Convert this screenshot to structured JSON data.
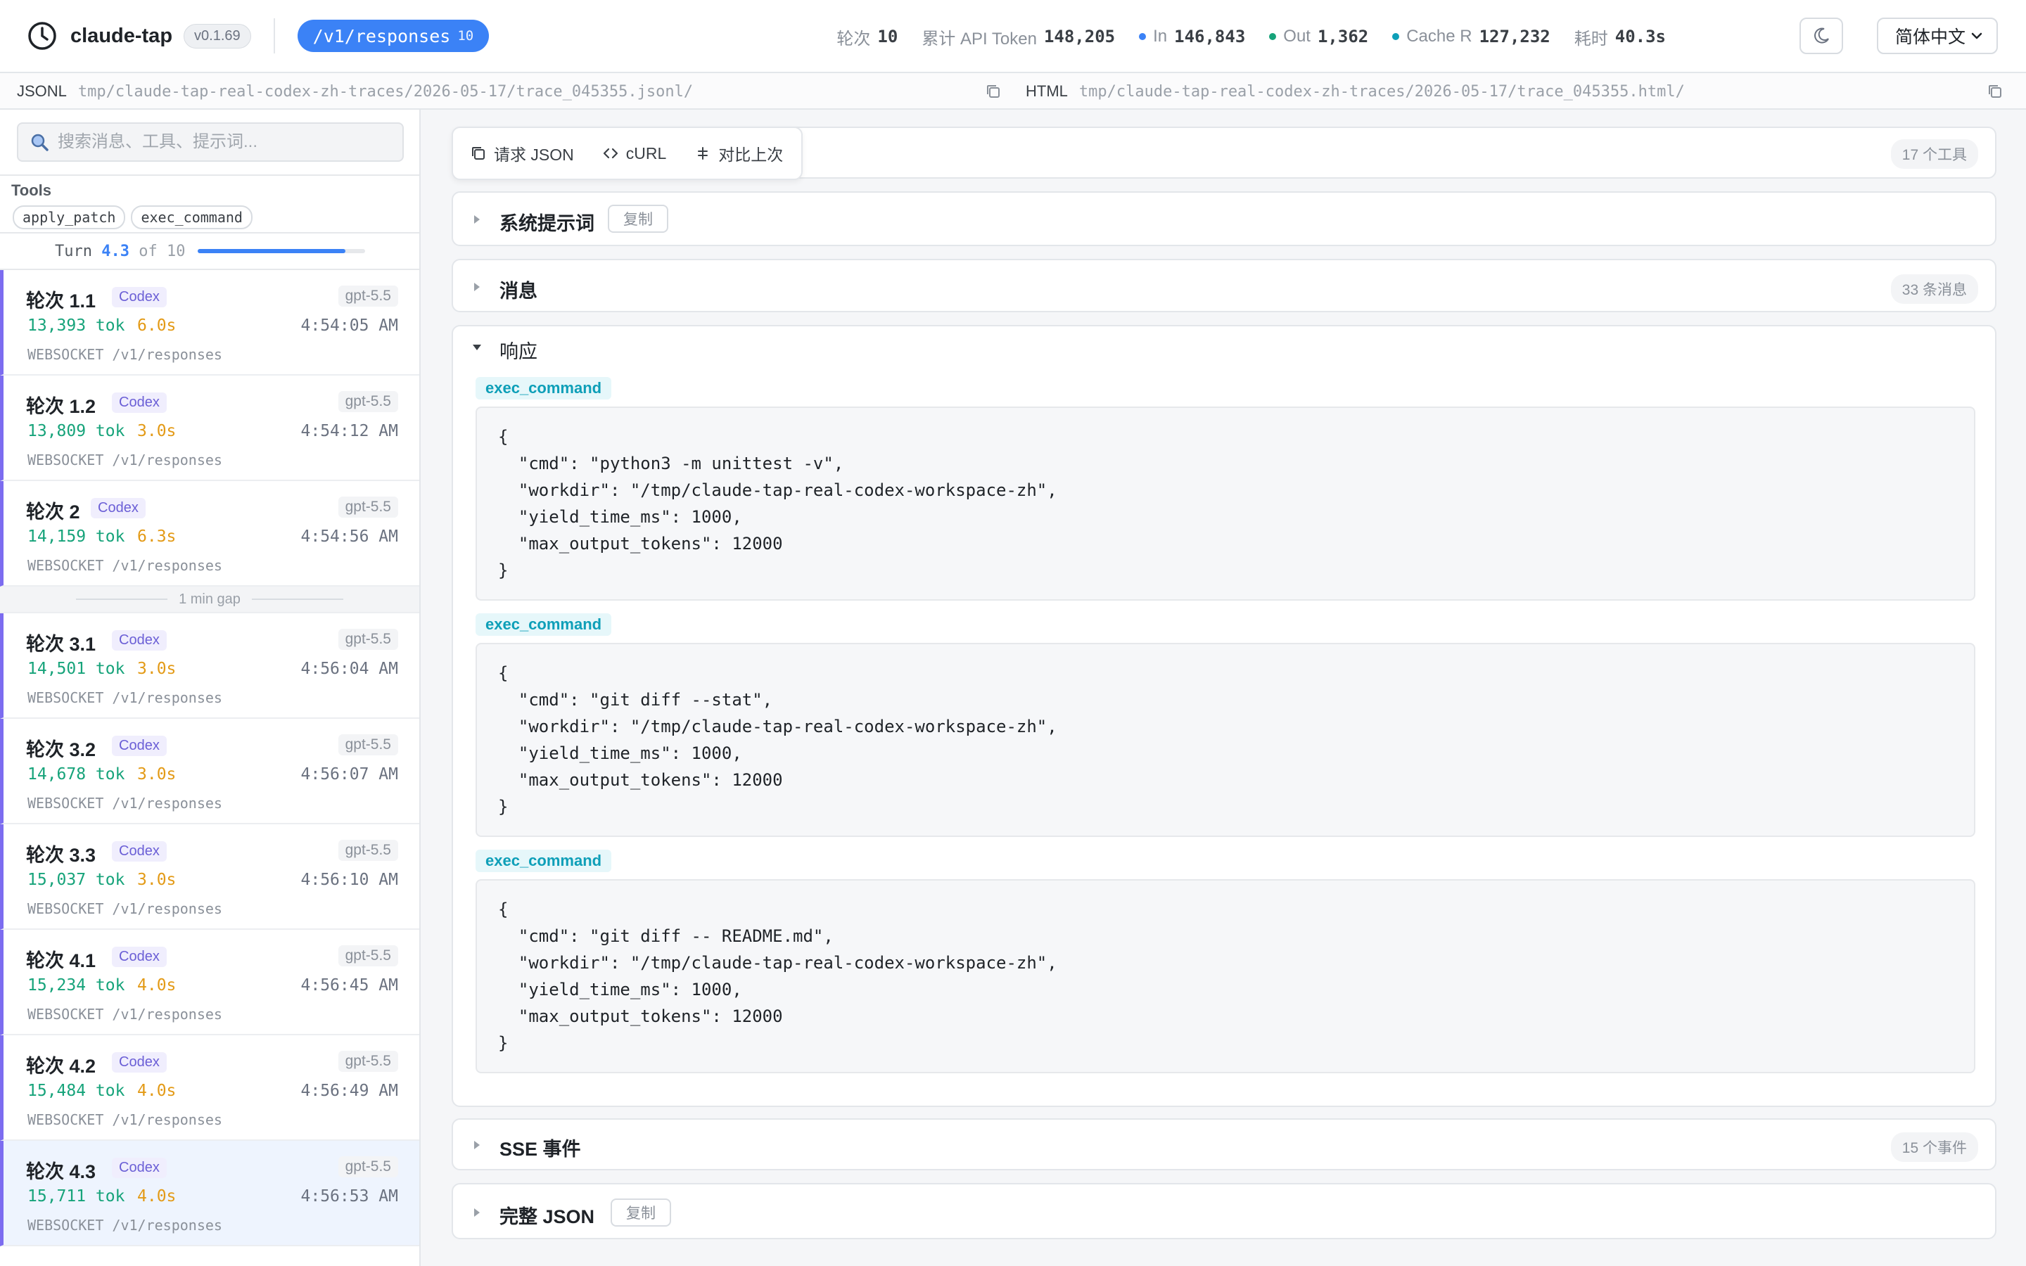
{
  "header": {
    "app_name": "claude-tap",
    "version": "v0.1.69",
    "endpoint": "/v1/responses",
    "endpoint_count": "10",
    "stats": {
      "turns_label": "轮次",
      "turns_value": "10",
      "tokens_label": "累计 API Token",
      "tokens_value": "148,205",
      "in_label": "In",
      "in_value": "146,843",
      "out_label": "Out",
      "out_value": "1,362",
      "cache_label": "Cache R",
      "cache_value": "127,232",
      "time_label": "耗时",
      "time_value": "40.3s"
    },
    "theme_icon": "moon-icon",
    "language": "简体中文"
  },
  "paths": {
    "jsonl_label": "JSONL",
    "jsonl_value": "tmp/claude-tap-real-codex-zh-traces/2026-05-17/trace_045355.jsonl/",
    "html_label": "HTML",
    "html_value": "tmp/claude-tap-real-codex-zh-traces/2026-05-17/trace_045355.html/"
  },
  "sidebar": {
    "search_placeholder": "搜索消息、工具、提示词...",
    "tools_title": "Tools",
    "tools": [
      "apply_patch",
      "exec_command"
    ],
    "turn_prefix": "Turn",
    "turn_current": "4.3",
    "turn_of": "of 10",
    "progress_fraction": 0.88,
    "gap_label": "1 min gap",
    "turns": [
      {
        "name": "轮次 1.1",
        "agent": "Codex",
        "model": "gpt-5.5",
        "tokens": "13,393 tok",
        "duration": "6.0s",
        "time": "4:54:05 AM",
        "route": "WEBSOCKET /v1/responses"
      },
      {
        "name": "轮次 1.2",
        "agent": "Codex",
        "model": "gpt-5.5",
        "tokens": "13,809 tok",
        "duration": "3.0s",
        "time": "4:54:12 AM",
        "route": "WEBSOCKET /v1/responses"
      },
      {
        "name": "轮次 2",
        "agent": "Codex",
        "model": "gpt-5.5",
        "tokens": "14,159 tok",
        "duration": "6.3s",
        "time": "4:54:56 AM",
        "route": "WEBSOCKET /v1/responses"
      },
      {
        "name": "轮次 3.1",
        "agent": "Codex",
        "model": "gpt-5.5",
        "tokens": "14,501 tok",
        "duration": "3.0s",
        "time": "4:56:04 AM",
        "route": "WEBSOCKET /v1/responses"
      },
      {
        "name": "轮次 3.2",
        "agent": "Codex",
        "model": "gpt-5.5",
        "tokens": "14,678 tok",
        "duration": "3.0s",
        "time": "4:56:07 AM",
        "route": "WEBSOCKET /v1/responses"
      },
      {
        "name": "轮次 3.3",
        "agent": "Codex",
        "model": "gpt-5.5",
        "tokens": "15,037 tok",
        "duration": "3.0s",
        "time": "4:56:10 AM",
        "route": "WEBSOCKET /v1/responses"
      },
      {
        "name": "轮次 4.1",
        "agent": "Codex",
        "model": "gpt-5.5",
        "tokens": "15,234 tok",
        "duration": "4.0s",
        "time": "4:56:45 AM",
        "route": "WEBSOCKET /v1/responses"
      },
      {
        "name": "轮次 4.2",
        "agent": "Codex",
        "model": "gpt-5.5",
        "tokens": "15,484 tok",
        "duration": "4.0s",
        "time": "4:56:49 AM",
        "route": "WEBSOCKET /v1/responses"
      },
      {
        "name": "轮次 4.3",
        "agent": "Codex",
        "model": "gpt-5.5",
        "tokens": "15,711 tok",
        "duration": "4.0s",
        "time": "4:56:53 AM",
        "route": "WEBSOCKET /v1/responses"
      }
    ]
  },
  "main": {
    "toolbar": {
      "request_json": "请求 JSON",
      "curl": "cURL",
      "diff": "对比上次"
    },
    "tools_count": "17 个工具",
    "system_prompt": {
      "title": "系统提示词",
      "copy": "复制"
    },
    "messages": {
      "title": "消息",
      "count": "33 条消息"
    },
    "response": {
      "title": "响应",
      "calls": [
        {
          "tool": "exec_command",
          "lines": [
            "{",
            "  \"cmd\": \"python3 -m unittest -v\",",
            "  \"workdir\": \"/tmp/claude-tap-real-codex-workspace-zh\",",
            "  \"yield_time_ms\": 1000,",
            "  \"max_output_tokens\": 12000",
            "}"
          ]
        },
        {
          "tool": "exec_command",
          "lines": [
            "{",
            "  \"cmd\": \"git diff --stat\",",
            "  \"workdir\": \"/tmp/claude-tap-real-codex-workspace-zh\",",
            "  \"yield_time_ms\": 1000,",
            "  \"max_output_tokens\": 12000",
            "}"
          ]
        },
        {
          "tool": "exec_command",
          "lines": [
            "{",
            "  \"cmd\": \"git diff -- README.md\",",
            "  \"workdir\": \"/tmp/claude-tap-real-codex-workspace-zh\",",
            "  \"yield_time_ms\": 1000,",
            "  \"max_output_tokens\": 12000",
            "}"
          ]
        }
      ]
    },
    "sse": {
      "title": "SSE 事件",
      "count": "15 个事件"
    },
    "full_json": {
      "title": "完整 JSON",
      "copy": "复制"
    }
  },
  "colors": {
    "accent": "#3b82f6",
    "turn_bar": "#7c6cf0",
    "tokens": "#16a37a",
    "duration": "#e39a16",
    "tool_label": "#0e9fb8",
    "dot_in": "#3b82f6",
    "dot_out": "#16a37a",
    "dot_cache": "#0e9fb8"
  }
}
